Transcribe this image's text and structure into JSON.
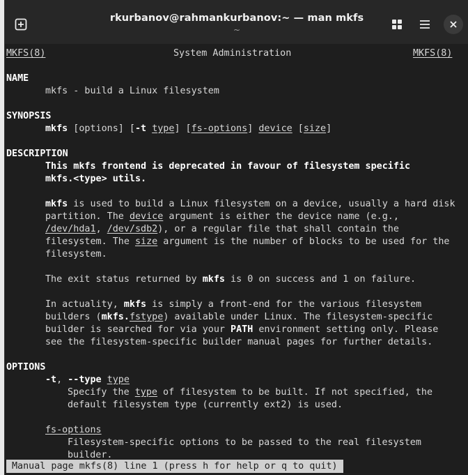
{
  "window": {
    "title": "rkurbanov@rahmankurbanov:~ — man mkfs",
    "subtitle": "~"
  },
  "icons": {
    "new_tab": "new-tab-icon",
    "grid": "grid-icon",
    "menu": "hamburger-menu-icon",
    "close": "close-icon"
  },
  "man": {
    "header_left": "MKFS(8)",
    "header_center": "System Administration",
    "header_right": "MKFS(8)",
    "name_heading": "NAME",
    "name_text": "mkfs - build a Linux filesystem",
    "synopsis_heading": "SYNOPSIS",
    "synopsis_cmd": "mkfs",
    "synopsis_rest_a": " [options] [",
    "synopsis_t": "-t",
    "synopsis_rest_b": " ",
    "synopsis_type": "type",
    "synopsis_rest_c": "] [",
    "synopsis_fsopts": "fs-options",
    "synopsis_rest_d": "] ",
    "synopsis_device": "device",
    "synopsis_rest_e": " [",
    "synopsis_size": "size",
    "synopsis_rest_f": "]",
    "description_heading": "DESCRIPTION",
    "desc_bold_1": "This mkfs frontend is deprecated in favour of filesystem specific",
    "desc_bold_2": "mkfs.<type> utils.",
    "p1_l1_cmd": "mkfs",
    "p1_l1_rest": " is used to build a Linux filesystem on a device, usually a hard disk",
    "p1_l2_a": "partition. The ",
    "p1_l2_device": "device",
    "p1_l2_b": " argument is either the device name (e.g.,",
    "p1_l3_hda1": "/dev/hda1",
    "p1_l3_a": ", ",
    "p1_l3_sdb2": "/dev/sdb2",
    "p1_l3_b": "), or a regular file that shall contain the",
    "p1_l4_a": "filesystem. The ",
    "p1_l4_size": "size",
    "p1_l4_b": " argument is the number of blocks to be used for the",
    "p1_l5": "filesystem.",
    "p2_a": "The exit status returned by ",
    "p2_cmd": "mkfs",
    "p2_b": " is 0 on success and 1 on failure.",
    "p3_l1_a": "In actuality, ",
    "p3_l1_cmd": "mkfs",
    "p3_l1_b": " is simply a front-end for the various filesystem",
    "p3_l2_a": "builders (",
    "p3_l2_mkfs": "mkfs.",
    "p3_l2_fstype": "fstype",
    "p3_l2_b": ") available under Linux. The filesystem-specific",
    "p3_l3_a": "builder is searched for via your ",
    "p3_l3_path": "PATH",
    "p3_l3_b": " environment setting only. Please",
    "p3_l4": "see the filesystem-specific builder manual pages for further details.",
    "options_heading": "OPTIONS",
    "opt_t": "-t",
    "opt_sep": ", ",
    "opt_type_long": "--type",
    "opt_sp": " ",
    "opt_type_arg": "type",
    "opt_t_l1_a": "Specify the ",
    "opt_t_l1_type": "type",
    "opt_t_l1_b": " of filesystem to be built. If not specified, the",
    "opt_t_l2": "default filesystem type (currently ext2) is used.",
    "opt_fsopts": "fs-options",
    "opt_fsopts_l1": "Filesystem-specific options to be passed to the real filesystem",
    "opt_fsopts_l2": "builder."
  },
  "status_bar": "Manual page mkfs(8) line 1 (press h for help or q to quit)"
}
